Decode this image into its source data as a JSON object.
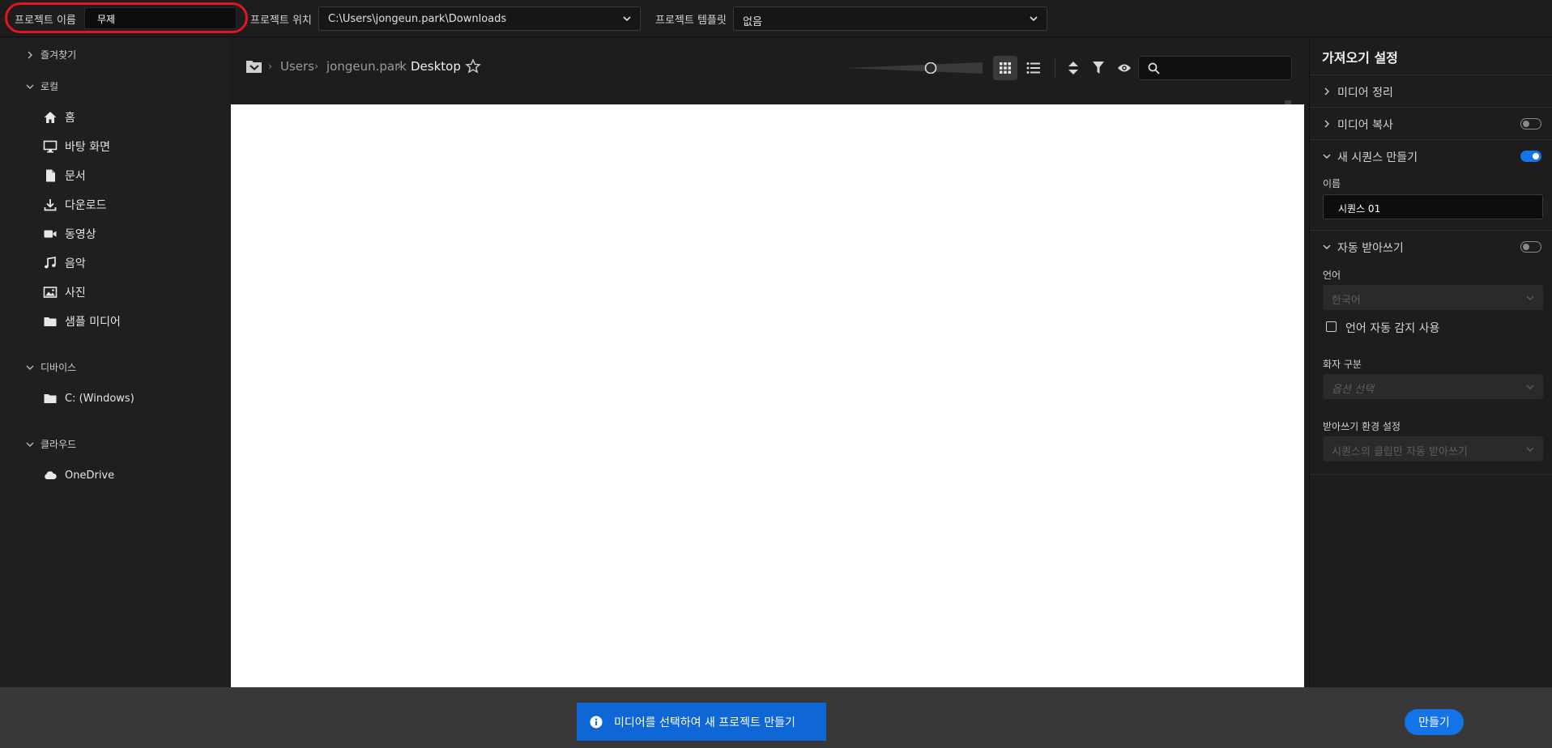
{
  "topbar": {
    "project_name_label": "프로젝트 이름",
    "project_name_value": "무제",
    "project_location_label": "프로젝트 위치",
    "project_location_value": "C:\\Users\\jongeun.park\\Downloads",
    "project_template_label": "프로젝트 템플릿",
    "project_template_value": "없음"
  },
  "sidebar": {
    "favorites": "즐겨찾기",
    "local": "로컬",
    "local_items": [
      {
        "label": "홈",
        "icon": "home-icon"
      },
      {
        "label": "바탕 화면",
        "icon": "desktop-icon"
      },
      {
        "label": "문서",
        "icon": "document-icon"
      },
      {
        "label": "다운로드",
        "icon": "download-icon"
      },
      {
        "label": "동영상",
        "icon": "video-icon"
      },
      {
        "label": "음악",
        "icon": "music-icon"
      },
      {
        "label": "사진",
        "icon": "photo-icon"
      },
      {
        "label": "샘플 미디어",
        "icon": "folder-icon"
      }
    ],
    "devices": "디바이스",
    "device_items": [
      {
        "label": "C: (Windows)",
        "icon": "folder-icon"
      }
    ],
    "cloud": "클라우드",
    "cloud_items": [
      {
        "label": "OneDrive",
        "icon": "cloud-icon"
      }
    ]
  },
  "browser": {
    "breadcrumb": [
      "Users",
      "jongeun.park",
      "Desktop"
    ],
    "view_mode": "grid"
  },
  "import_settings": {
    "title": "가져오기 설정",
    "media_organize": "미디어 정리",
    "media_copy": "미디어 복사",
    "media_copy_on": false,
    "new_sequence": "새 시퀀스 만들기",
    "new_sequence_on": true,
    "name_label": "이름",
    "name_value": "시퀀스 01",
    "auto_transcribe": "자동 받아쓰기",
    "auto_transcribe_on": false,
    "language_label": "언어",
    "language_value": "한국어",
    "auto_detect_label": "언어 자동 감지 사용",
    "auto_detect_checked": false,
    "speaker_label": "화자 구분",
    "speaker_value": "옵션 선택",
    "transcribe_pref_label": "받아쓰기 환경 설정",
    "transcribe_pref_value": "시퀀스의 클립만 자동 받아쓰기"
  },
  "footer": {
    "notice": "미디어를 선택하여 새 프로젝트 만들기",
    "create_button": "만들기"
  },
  "colors": {
    "accent": "#1473e6",
    "highlight_ring": "#e4151d",
    "background": "#1d1d1d"
  }
}
